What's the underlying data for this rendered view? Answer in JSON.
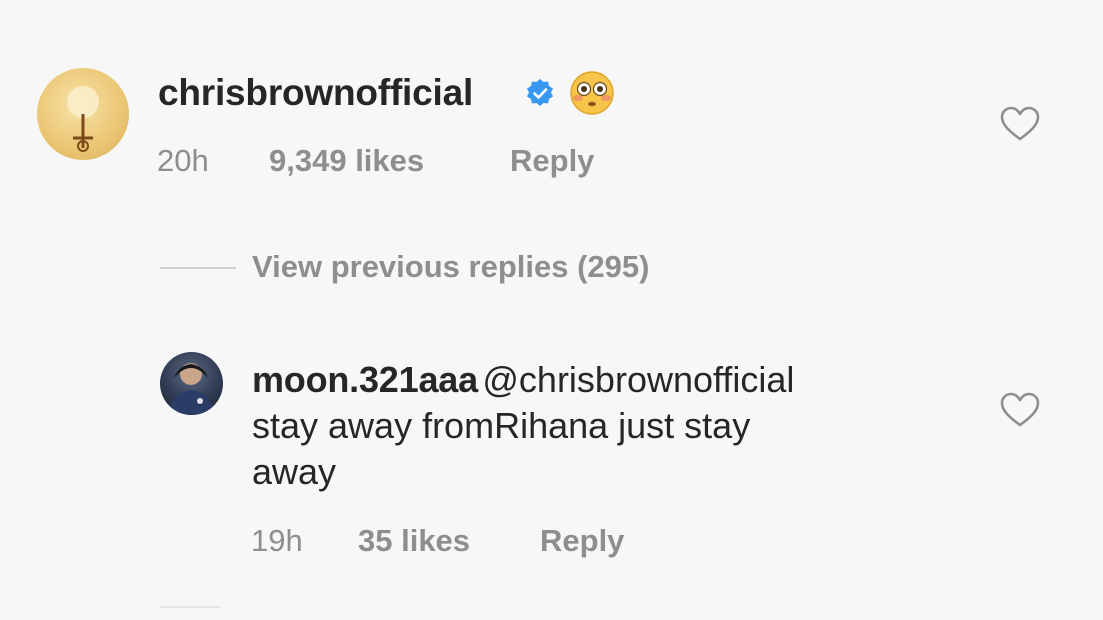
{
  "comment": {
    "username": "chrisbrownofficial",
    "verified_icon": "verified-badge-icon",
    "emoji": "flushed-face-emoji",
    "time": "20h",
    "likes": "9,349 likes",
    "reply_label": "Reply",
    "like_icon": "heart-outline-icon"
  },
  "replies_toggle": {
    "label": "View previous replies (295)"
  },
  "reply": {
    "username": "moon.321aaa",
    "mention": "@chrisbrownofficial",
    "text_line1": "stay away fromRihana just stay",
    "text_line2": "away",
    "time": "19h",
    "likes": "35 likes",
    "reply_label": "Reply",
    "like_icon": "heart-outline-icon"
  },
  "colors": {
    "background": "#f7f7f7",
    "primary_text": "#262626",
    "secondary_text": "#8e8e8e",
    "verified_blue": "#3897f0",
    "mention": "#1d3a66"
  }
}
